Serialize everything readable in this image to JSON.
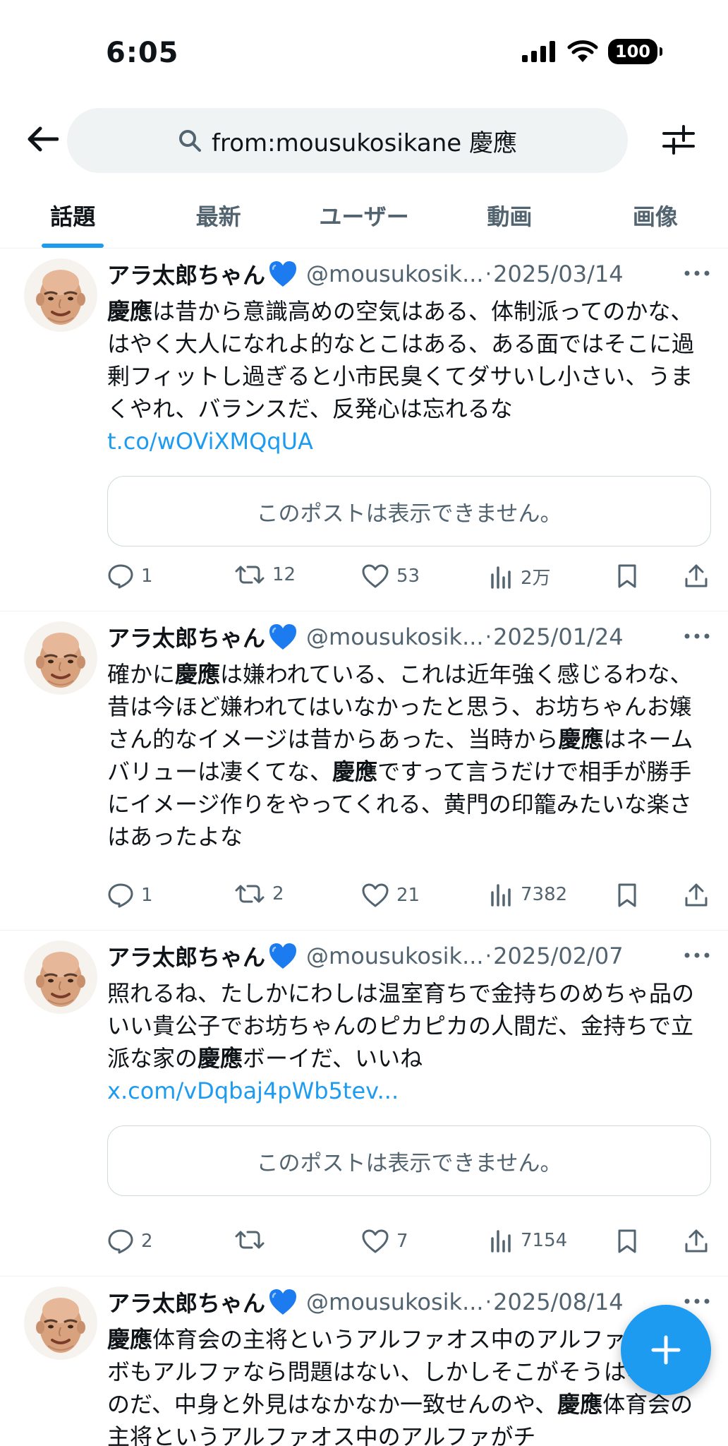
{
  "status_bar": {
    "time": "6:05",
    "battery": "100"
  },
  "search": {
    "query": "from:mousukosikane 慶應"
  },
  "tabs": [
    {
      "label": "話題",
      "active": true
    },
    {
      "label": "最新",
      "active": false
    },
    {
      "label": "ユーザー",
      "active": false
    },
    {
      "label": "動画",
      "active": false
    },
    {
      "label": "画像",
      "active": false
    }
  ],
  "colors": {
    "accent": "#1d9bf0",
    "secondary_text": "#536471",
    "badge": "#1d7bf0"
  },
  "posts": [
    {
      "author": "アラ太郎ちゃん",
      "badge": "blue-heart",
      "handle": "@mousukosik...",
      "separator": "·",
      "date": "2025/03/14",
      "body_segments": [
        {
          "text": "慶應",
          "bold": true
        },
        {
          "text": "は昔から意識高めの空気はある、体制派ってのかな、はやく大人になれよ的なとこはある、ある面ではそこに過剰フィットし過ぎると小市民臭くてダサいし小さい、うまくやれ、バランスだ、反発心は忘れるな "
        },
        {
          "text": "t.co/wOViXMQqUA",
          "link": true
        }
      ],
      "unavailable": "このポストは表示できません。",
      "replies": "1",
      "reposts": "12",
      "likes": "53",
      "views": "2万"
    },
    {
      "author": "アラ太郎ちゃん",
      "badge": "blue-heart",
      "handle": "@mousukosik...",
      "separator": "·",
      "date": "2025/01/24",
      "body_segments": [
        {
          "text": "確かに"
        },
        {
          "text": "慶應",
          "bold": true
        },
        {
          "text": "は嫌われている、これは近年強く感じるわな、昔は今ほど嫌われてはいなかったと思う、お坊ちゃんお嬢さん的なイメージは昔からあった、当時から"
        },
        {
          "text": "慶應",
          "bold": true
        },
        {
          "text": "はネームバリューは凄くてな、"
        },
        {
          "text": "慶應",
          "bold": true
        },
        {
          "text": "ですって言うだけで相手が勝手にイメージ作りをやってくれる、黄門の印籠みたいな楽さはあったよな"
        }
      ],
      "unavailable": null,
      "replies": "1",
      "reposts": "2",
      "likes": "21",
      "views": "7382"
    },
    {
      "author": "アラ太郎ちゃん",
      "badge": "blue-heart",
      "handle": "@mousukosik...",
      "separator": "·",
      "date": "2025/02/07",
      "body_segments": [
        {
          "text": "照れるね、たしかにわしは温室育ちで金持ちのめちゃ品のいい貴公子でお坊ちゃんのピカピカの人間だ、金持ちで立派な家の"
        },
        {
          "text": "慶應",
          "bold": true
        },
        {
          "text": "ボーイだ、いいね "
        },
        {
          "text": "x.com/vDqbaj4pWb5tev...",
          "link": true
        }
      ],
      "unavailable": "このポストは表示できません。",
      "replies": "2",
      "reposts": "",
      "likes": "7",
      "views": "7154"
    },
    {
      "author": "アラ太郎ちゃん",
      "badge": "blue-heart",
      "handle": "@mousukosik...",
      "separator": "·",
      "date": "2025/08/14",
      "body_segments": [
        {
          "text": "慶應",
          "bold": true
        },
        {
          "text": "体育会の主将というアルファオス中のアルファがチンボもアルファなら問題はない、しかしそこがそうはならんのだ、中身と外見はなかなか一致せんのや、"
        },
        {
          "text": "慶應",
          "bold": true
        },
        {
          "text": "体育会の主将というアルファオス中のアルファがチ"
        }
      ],
      "unavailable": null,
      "replies": "",
      "reposts": "",
      "likes": "",
      "views": ""
    }
  ],
  "fab": {
    "icon": "plus-icon"
  }
}
